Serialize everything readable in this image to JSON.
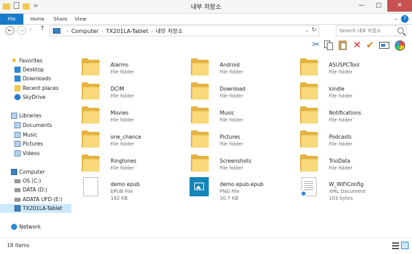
{
  "window": {
    "title": "내부 저장소",
    "minimize": "—",
    "maximize": "□",
    "close": "✕"
  },
  "ribbon": {
    "tabs": [
      "File",
      "Home",
      "Share",
      "View"
    ],
    "toggle": "⌄",
    "help": "?"
  },
  "address": {
    "crumbs": [
      "Computer",
      "TX201LA-Tablet",
      "내부 저장소"
    ],
    "dropdown": "⌄",
    "refresh": "↻"
  },
  "search": {
    "placeholder": "Search 내부 저장소"
  },
  "nav": {
    "back": "←",
    "forward": "→",
    "recent": "⌄",
    "up": "↑"
  },
  "navpane": {
    "favorites": "Favorites",
    "desktop": "Desktop",
    "downloads": "Downloads",
    "recent": "Recent places",
    "skydrive": "SkyDrive",
    "libraries": "Libraries",
    "documents": "Documents",
    "music": "Music",
    "pictures": "Pictures",
    "videos": "Videos",
    "computer": "Computer",
    "os": "OS (C:)",
    "data": "DATA (D:)",
    "adata": "ADATA UFD (E:)",
    "tablet": "TX201LA-Tablet",
    "network": "Network"
  },
  "items": [
    {
      "name": "Alarms",
      "type": "File folder"
    },
    {
      "name": "Android",
      "type": "File folder"
    },
    {
      "name": "ASUSPCTool",
      "type": "File folder"
    },
    {
      "name": "DCIM",
      "type": "File folder"
    },
    {
      "name": "Download",
      "type": "File folder"
    },
    {
      "name": "kindle",
      "type": "File folder"
    },
    {
      "name": "Movies",
      "type": "File folder"
    },
    {
      "name": "Music",
      "type": "File folder"
    },
    {
      "name": "Notifications",
      "type": "File folder"
    },
    {
      "name": "one_chance",
      "type": "File folder"
    },
    {
      "name": "Pictures",
      "type": "File folder"
    },
    {
      "name": "Podcasts",
      "type": "File folder"
    },
    {
      "name": "Ringtones",
      "type": "File folder"
    },
    {
      "name": "Screenshots",
      "type": "File folder"
    },
    {
      "name": "TrioData",
      "type": "File folder"
    },
    {
      "name": "demo epub",
      "type": "EPUB File",
      "size": "182 KB"
    },
    {
      "name": "demo epub.epub",
      "type": "PNG File",
      "size": "30.7 KB"
    },
    {
      "name": "W_WiFiConfig",
      "type": "XML Document",
      "size": "103 bytes"
    }
  ],
  "status": {
    "count": "18 items"
  }
}
